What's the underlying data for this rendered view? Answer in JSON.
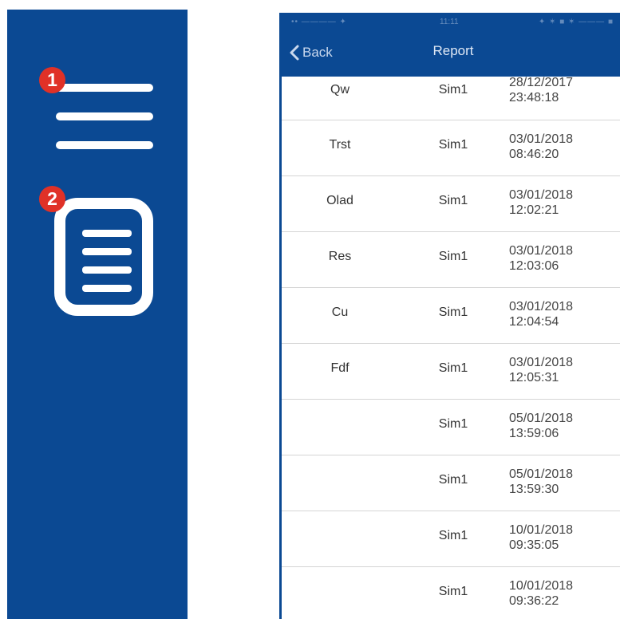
{
  "badges": {
    "menu": "1",
    "report": "2"
  },
  "phone": {
    "status": {
      "carrier": "•• ———— ✦",
      "time": "11:11",
      "right": "✦ ✶ ■ ✶ ——— ■"
    },
    "navbar": {
      "back_label": "Back",
      "title": "Report"
    },
    "rows": [
      {
        "name": "Qw",
        "sim": "Sim1",
        "date": "28/12/2017",
        "time": "23:48:18"
      },
      {
        "name": "Trst",
        "sim": "Sim1",
        "date": "03/01/2018",
        "time": "08:46:20"
      },
      {
        "name": "Olad",
        "sim": "Sim1",
        "date": "03/01/2018",
        "time": "12:02:21"
      },
      {
        "name": "Res",
        "sim": "Sim1",
        "date": "03/01/2018",
        "time": "12:03:06"
      },
      {
        "name": "Cu",
        "sim": "Sim1",
        "date": "03/01/2018",
        "time": "12:04:54"
      },
      {
        "name": "Fdf",
        "sim": "Sim1",
        "date": "03/01/2018",
        "time": "12:05:31"
      },
      {
        "name": "",
        "sim": "Sim1",
        "date": "05/01/2018",
        "time": "13:59:06"
      },
      {
        "name": "",
        "sim": "Sim1",
        "date": "05/01/2018",
        "time": "13:59:30"
      },
      {
        "name": "",
        "sim": "Sim1",
        "date": "10/01/2018",
        "time": "09:35:05"
      },
      {
        "name": "",
        "sim": "Sim1",
        "date": "10/01/2018",
        "time": "09:36:22"
      }
    ]
  },
  "colors": {
    "brand_blue": "#0b4993",
    "badge_red": "#e03127"
  },
  "icons": {
    "menu": "hamburger-menu-icon",
    "report": "document-report-icon",
    "back": "chevron-left-icon"
  }
}
